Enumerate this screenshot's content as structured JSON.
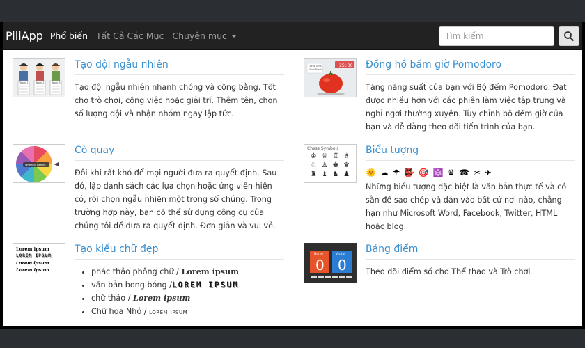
{
  "navbar": {
    "brand": "PiliApp",
    "links": [
      {
        "label": "Phổ biến"
      },
      {
        "label": "Tất Cả Các Mục"
      },
      {
        "label": "Chuyên mục"
      }
    ],
    "search_placeholder": "Tìm kiếm",
    "search_icon": "search-icon"
  },
  "cards": {
    "team": {
      "title": "Tạo đội ngẫu nhiên",
      "desc": "Tạo đội ngẫu nhiên nhanh chóng và công bằng. Tốt cho trò chơi, công việc hoặc giải trí. Thêm tên, chọn số lượng đội và nhận nhóm ngay lập tức.",
      "thumb_labels": [
        "Team 1",
        "Team 2",
        "Team 3"
      ]
    },
    "pomodoro": {
      "title": "Đồng hồ bấm giờ Pomodoro",
      "desc": "Tăng năng suất của bạn với Bộ đếm Pomodoro. Đạt được nhiều hơn với các phiên làm việc tập trung và nghỉ ngơi thường xuyên. Tùy chỉnh bộ đếm giờ của bạn và dễ dàng theo dõi tiến trình của bạn.",
      "thumb_time": "25:00",
      "thumb_labels": [
        "Focus Time",
        "Short Break"
      ]
    },
    "wheel": {
      "title": "Cò quay",
      "desc": "Đôi khi rất khó để mọi người đưa ra quyết định. Sau đó, lập danh sách các lựa chọn hoặc ứng viên hiện có, rồi chọn ngẫu nhiên một trong số chúng. Trong trường hợp này, bạn có thể sử dụng công cụ của chúng tôi để đưa ra quyết định. Đơn giản và vui vẻ.",
      "thumb_label": "Wheel of Names"
    },
    "symbols": {
      "title": "Biểu tượng",
      "symbols": "🌞 ☁ ☂ 👺 🎯 🔯 ♛ ☎ ✂ ✈",
      "desc": "Những biểu tượng đặc biệt là văn bản thực tế và có sẵn để sao chép và dán vào bất cứ nơi nào, chẳng hạn như Microsoft Word, Facebook, Twitter, HTML hoặc blog.",
      "thumb_label": "Chess Symbols",
      "thumb_glyphs": [
        "♔",
        "♕",
        "♖",
        "♗",
        "♘",
        "♙",
        "♚",
        "♛",
        "♜",
        "♝",
        "♞",
        "♟"
      ]
    },
    "fonts": {
      "title": "Tạo kiểu chữ đẹp",
      "items": [
        {
          "label": "phác thảo phông chữ / ",
          "sample": "Lorem ipsum"
        },
        {
          "label": "văn bản bong bóng /",
          "sample": "LOREM IPSUM"
        },
        {
          "label": "chữ thảo / ",
          "sample": "Lorem ipsum"
        },
        {
          "label": "Chữ hoa Nhỏ / ",
          "sample": "lorem ipsum"
        }
      ],
      "thumb_lines": [
        "Lorem ipsum",
        "LOREM IPSUM",
        "Lorem ipsum",
        "Lorem ipsum"
      ]
    },
    "scoreboard": {
      "title": "Bảng điểm",
      "desc": "Theo dõi điểm số cho Thể thao và Trò chơi",
      "thumb_home": "Home",
      "thumb_visitor": "Visitor",
      "thumb_home_score": "0",
      "thumb_visitor_score": "0"
    }
  },
  "colors": {
    "link": "#3a8fd0",
    "navbar": "#222222",
    "home": "#e8542a",
    "visitor": "#2b7cd3"
  }
}
